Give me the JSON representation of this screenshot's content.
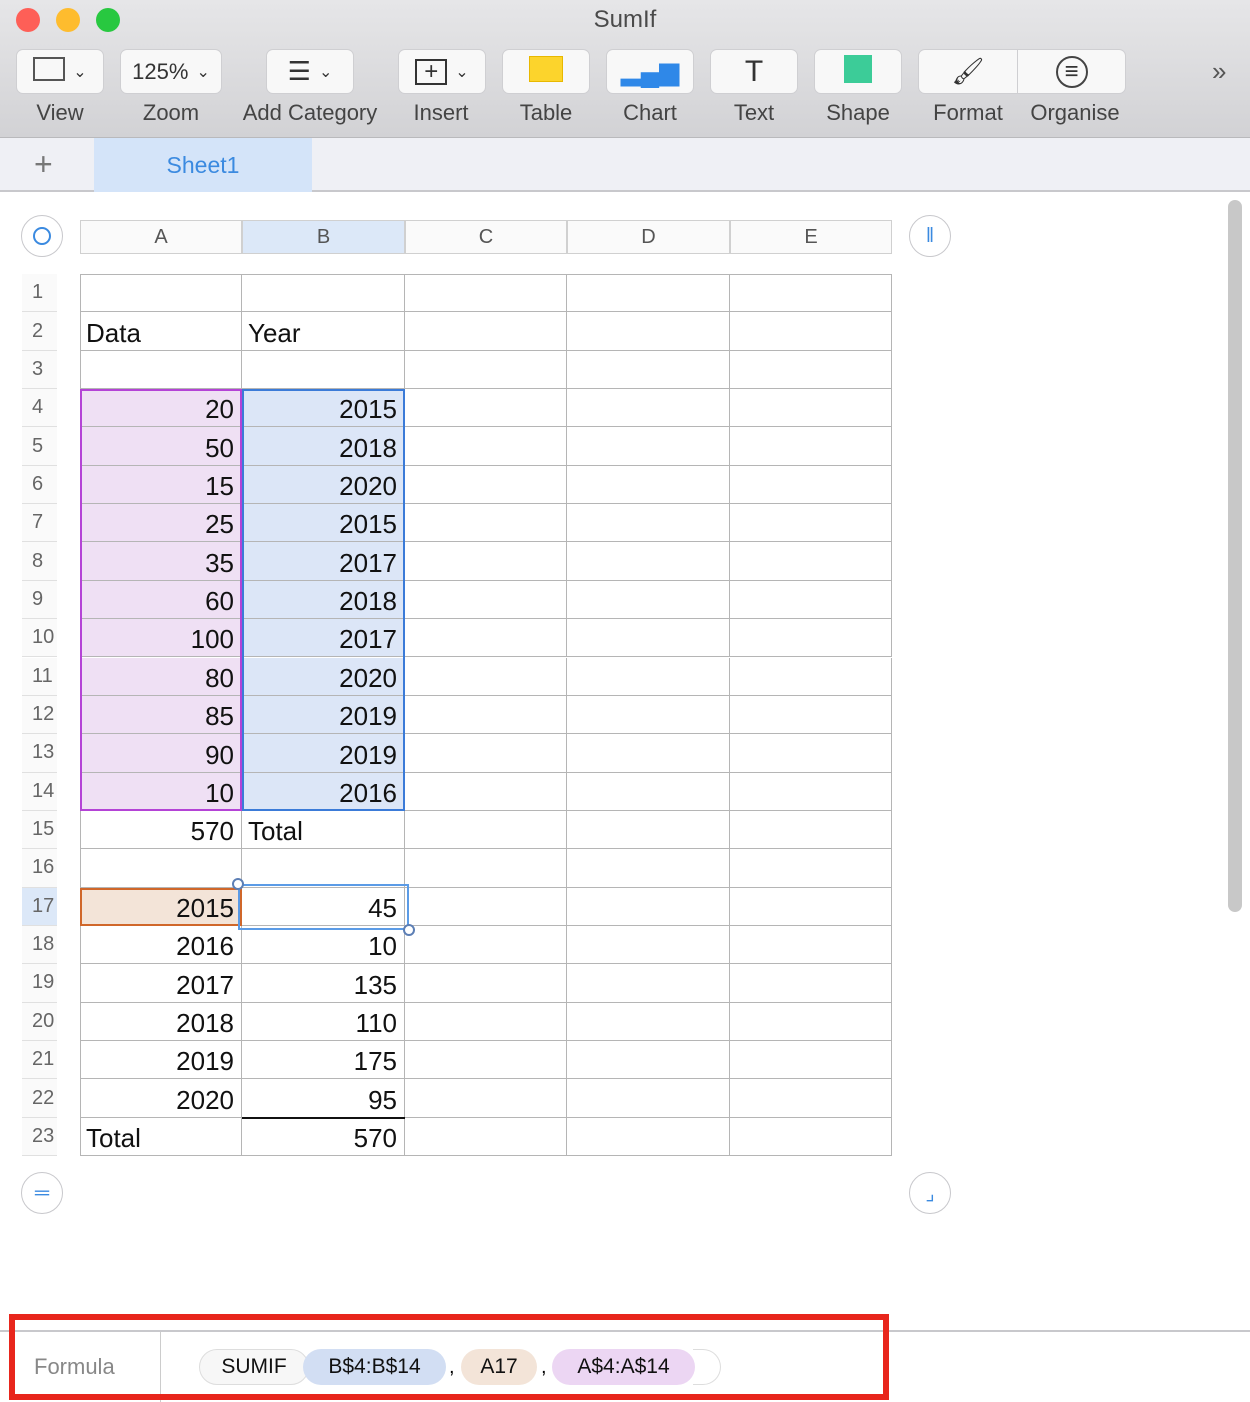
{
  "window": {
    "title": "SumIf"
  },
  "toolbar": [
    {
      "label": "View",
      "icon": "sidebar-view-icon"
    },
    {
      "label": "Zoom",
      "value": "125%",
      "icon": "zoom-dropdown"
    },
    {
      "label": "Add Category",
      "icon": "list-icon"
    },
    {
      "label": "Insert",
      "icon": "insert-icon"
    },
    {
      "label": "Table",
      "icon": "table-icon"
    },
    {
      "label": "Chart",
      "icon": "chart-icon"
    },
    {
      "label": "Text",
      "icon": "text-icon"
    },
    {
      "label": "Shape",
      "icon": "shape-icon"
    },
    {
      "label": "Format",
      "icon": "paintbrush-icon"
    },
    {
      "label": "Organise",
      "icon": "filter-icon"
    }
  ],
  "overflow": "»",
  "tabs": {
    "add": "+",
    "sheets": [
      "Sheet1"
    ]
  },
  "columns": [
    "A",
    "B",
    "C",
    "D",
    "E"
  ],
  "rows": [
    [
      "",
      ""
    ],
    [
      "Data",
      "Year"
    ],
    [
      "",
      ""
    ],
    [
      "20",
      "2015"
    ],
    [
      "50",
      "2018"
    ],
    [
      "15",
      "2020"
    ],
    [
      "25",
      "2015"
    ],
    [
      "35",
      "2017"
    ],
    [
      "60",
      "2018"
    ],
    [
      "100",
      "2017"
    ],
    [
      "80",
      "2020"
    ],
    [
      "85",
      "2019"
    ],
    [
      "90",
      "2019"
    ],
    [
      "10",
      "2016"
    ],
    [
      "570",
      "Total"
    ],
    [
      "",
      ""
    ],
    [
      "2015",
      "45"
    ],
    [
      "2016",
      "10"
    ],
    [
      "2017",
      "135"
    ],
    [
      "2018",
      "110"
    ],
    [
      "2019",
      "175"
    ],
    [
      "2020",
      "95"
    ],
    [
      "Total",
      "570"
    ]
  ],
  "selected_cell": "B17",
  "formula_bar": {
    "label": "Formula",
    "function": "SUMIF",
    "args": [
      "B$4:B$14",
      "A17",
      "A$4:A$14"
    ],
    "separator": ","
  },
  "colors": {
    "accent": "#3b8ae0",
    "range_b": "#dce6f7",
    "range_a": "#efe0f4",
    "ref_a17": "#f3e4d8",
    "annotation": "#e8261c"
  }
}
